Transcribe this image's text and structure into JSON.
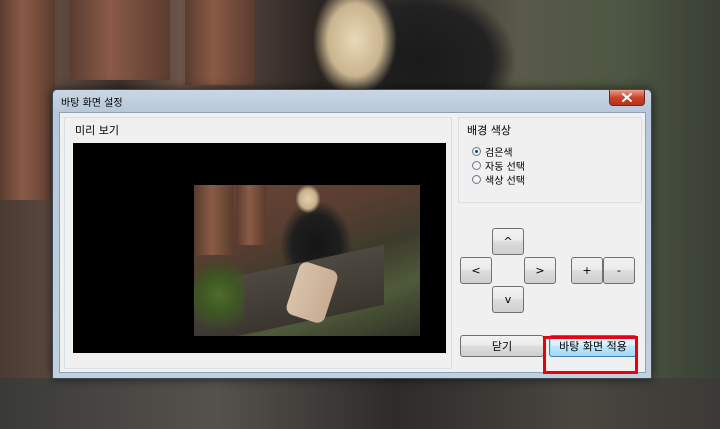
{
  "window": {
    "title": "바탕 화면 설정",
    "close_icon": "close-icon"
  },
  "preview": {
    "label": "미리 보기"
  },
  "background_color": {
    "label": "배경 색상",
    "options": [
      {
        "label": "검은색",
        "checked": true
      },
      {
        "label": "자동 선택",
        "checked": false
      },
      {
        "label": "색상 선택",
        "checked": false
      }
    ]
  },
  "controls": {
    "up": "^",
    "left": "<",
    "right": ">",
    "down": "v",
    "zoom_in": "+",
    "zoom_out": "-"
  },
  "footer": {
    "close_label": "닫기",
    "apply_label": "바탕 화면 적용"
  },
  "colors": {
    "highlight": "#e60012",
    "preview_background": "#000000"
  }
}
